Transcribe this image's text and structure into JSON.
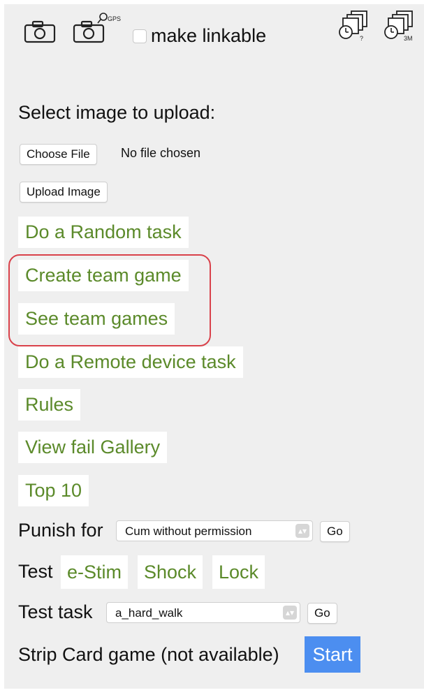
{
  "toolbar": {
    "icons": [
      "camera-icon",
      "camera-gps-icon",
      "clock-stack-help-icon",
      "clock-stack-3m-icon"
    ],
    "make_linkable_label": "make linkable",
    "gps_badge": "GPS",
    "clock_badge_1": "?",
    "clock_badge_2": "3M"
  },
  "upload": {
    "heading": "Select image to upload:",
    "choose_file_label": "Choose File",
    "no_file_text": "No file chosen",
    "upload_label": "Upload Image"
  },
  "links": [
    {
      "label": "Do a Random task"
    },
    {
      "label": "Create team game"
    },
    {
      "label": "See team games"
    },
    {
      "label": "Do a Remote device task"
    },
    {
      "label": "Rules"
    },
    {
      "label": "View fail Gallery"
    },
    {
      "label": "Top 10"
    }
  ],
  "punish": {
    "label": "Punish for",
    "selected": "Cum without permission",
    "go_label": "Go"
  },
  "test": {
    "label": "Test",
    "buttons": [
      "e-Stim",
      "Shock",
      "Lock"
    ]
  },
  "test_task": {
    "label": "Test task",
    "selected": "a_hard_walk",
    "go_label": "Go"
  },
  "strip_card": {
    "label": "Strip Card game (not available)",
    "start_label": "Start"
  },
  "colors": {
    "link_green": "#5b8a2a",
    "start_blue": "#4c8ef0",
    "highlight_red": "#d9414a",
    "panel_gray": "#efefef"
  }
}
